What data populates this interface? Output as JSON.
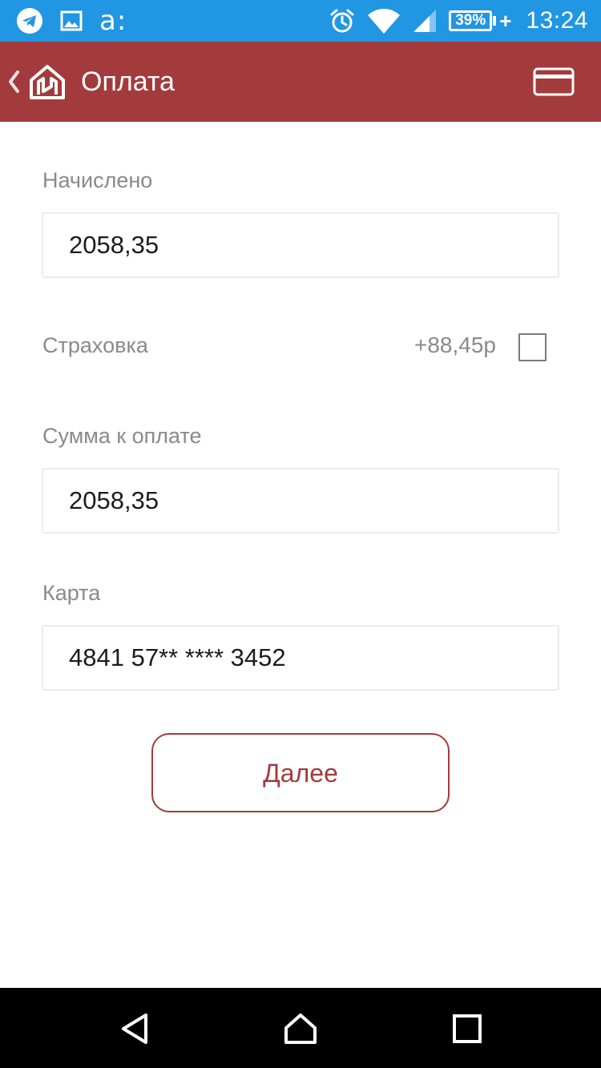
{
  "status_bar": {
    "left_icons": [
      "telegram-icon",
      "gallery-icon",
      "aw-icon"
    ],
    "aw_text": "a:",
    "right_icons": [
      "alarm-icon",
      "wifi-icon",
      "signal-icon"
    ],
    "battery_percent": "39%",
    "battery_charging_symbol": "+",
    "time": "13:24",
    "color": "#2196e3"
  },
  "app_bar": {
    "title": "Оплата",
    "back_icon": "chevron-left-icon",
    "logo_icon": "home-logo-icon",
    "action_icon": "credit-card-icon",
    "color": "#a33b3c"
  },
  "form": {
    "accrued": {
      "label": "Начислено",
      "value": "2058,35"
    },
    "insurance": {
      "label": "Страховка",
      "price": "+88,45р",
      "checked": false
    },
    "amount_due": {
      "label": "Сумма к оплате",
      "value": "2058,35"
    },
    "card": {
      "label": "Карта",
      "value": "4841 57** **** 3452"
    }
  },
  "next_button": {
    "label": "Далее"
  },
  "nav_bar": {
    "icons": [
      "back-triangle-icon",
      "home-icon",
      "recents-square-icon"
    ]
  }
}
